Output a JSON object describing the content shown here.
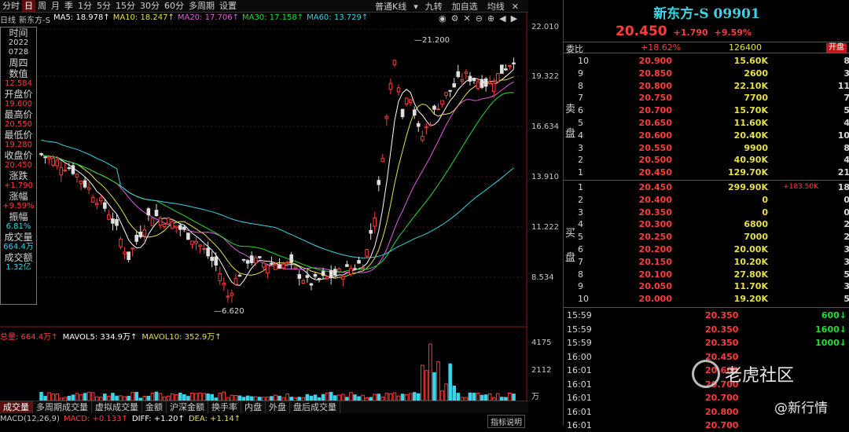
{
  "period_tabs": [
    "分时",
    "日",
    "周",
    "月",
    "季",
    "1分",
    "5分",
    "15分",
    "30分",
    "60分",
    "多周期",
    "设置"
  ],
  "active_period": "日",
  "toolbar": {
    "kline_type": "普通K线",
    "nine_turn": "九转",
    "add_watch": "加自选",
    "sort": "均线"
  },
  "ma_legend": [
    {
      "label": "日线",
      "color": "#c8c8c8"
    },
    {
      "label": "新东方-S",
      "color": "#c8c8c8"
    },
    {
      "label": "MA5: 18.978↑",
      "color": "#ffffff"
    },
    {
      "label": "MA10: 18.247↑",
      "color": "#e8e04a"
    },
    {
      "label": "MA20: 17.706↑",
      "color": "#e060e0"
    },
    {
      "label": "MA30: 17.158↑",
      "color": "#22dd33"
    },
    {
      "label": "MA60: 13.729↑",
      "color": "#3ad4e6"
    }
  ],
  "info_panel": [
    {
      "label": "时间",
      "value": "2022",
      "color": "#d8d8d8"
    },
    {
      "label": "",
      "value": "0728",
      "color": "#d8d8d8"
    },
    {
      "label": "周四",
      "value": "",
      "color": "#d8d8d8"
    },
    {
      "label": "数值",
      "value": "12.584",
      "color": "#ff3b3b"
    },
    {
      "label": "开盘价",
      "value": "19.600",
      "color": "#ff3b3b"
    },
    {
      "label": "最高价",
      "value": "20.550",
      "color": "#ff3b3b"
    },
    {
      "label": "最低价",
      "value": "19.280",
      "color": "#ff3b3b"
    },
    {
      "label": "收盘价",
      "value": "20.450",
      "color": "#ff3b3b"
    },
    {
      "label": "涨跌",
      "value": "+1.790",
      "color": "#ff3b3b"
    },
    {
      "label": "涨幅",
      "value": "+9.59%",
      "color": "#ff3b3b"
    },
    {
      "label": "振幅",
      "value": "6.81%",
      "color": "#3ad4e6"
    },
    {
      "label": "成交量",
      "value": "664.4万",
      "color": "#3ad4e6"
    },
    {
      "label": "成交额",
      "value": "1.32亿",
      "color": "#3ad4e6"
    }
  ],
  "y_axis": [
    "22.010",
    "19.322",
    "16.634",
    "13.910",
    "11.222",
    "8.534",
    "4175",
    "2112",
    "万"
  ],
  "annotations": {
    "high": "21.200",
    "low": "6.620"
  },
  "volume_legend": [
    {
      "label": "总量: 664.4万↑",
      "color": "#ff3b3b"
    },
    {
      "label": "MAVOL5: 334.9万↑",
      "color": "#ffffff"
    },
    {
      "label": "MAVOL10: 352.9万↑",
      "color": "#e8e04a"
    }
  ],
  "bottom_tabs": [
    "成交量",
    "多周期成交量",
    "虚拟成交量",
    "金额",
    "沪深金额",
    "换手率",
    "内盘",
    "外盘",
    "盘后成交量"
  ],
  "active_bottom_tab": "成交量",
  "macd_legend": [
    {
      "label": "MACD(12,26,9)",
      "color": "#c8c8c8"
    },
    {
      "label": "MACD: +0.133↑",
      "color": "#ff3b3b"
    },
    {
      "label": "DIFF: +1.20↑",
      "color": "#ffffff"
    },
    {
      "label": "DEA: +1.14↑",
      "color": "#e8e04a"
    }
  ],
  "indicator_button": "指标说明",
  "quote": {
    "name": "新东方-S 09901",
    "price": "20.450",
    "change": "+1.790",
    "change_pct": "+9.59%",
    "weibi_label": "委比",
    "weibi_value": "+18.62%",
    "weicha_value": "126400",
    "open_badge": "开盘"
  },
  "ask_label": [
    "卖",
    "盘"
  ],
  "bid_label": [
    "买",
    "盘"
  ],
  "asks": [
    {
      "level": "10",
      "price": "20.900",
      "vol": "15.60K",
      "cnt": "8"
    },
    {
      "level": "9",
      "price": "20.850",
      "vol": "2600",
      "cnt": "3"
    },
    {
      "level": "8",
      "price": "20.800",
      "vol": "22.10K",
      "cnt": "11"
    },
    {
      "level": "7",
      "price": "20.750",
      "vol": "7700",
      "cnt": "7"
    },
    {
      "level": "6",
      "price": "20.700",
      "vol": "15.70K",
      "cnt": "5"
    },
    {
      "level": "5",
      "price": "20.650",
      "vol": "11.60K",
      "cnt": "4"
    },
    {
      "level": "4",
      "price": "20.600",
      "vol": "20.40K",
      "cnt": "10"
    },
    {
      "level": "3",
      "price": "20.550",
      "vol": "9900",
      "cnt": "8"
    },
    {
      "level": "2",
      "price": "20.500",
      "vol": "40.90K",
      "cnt": "4"
    },
    {
      "level": "1",
      "price": "20.450",
      "vol": "129.70K",
      "cnt": "21"
    }
  ],
  "bids": [
    {
      "level": "1",
      "price": "20.450",
      "vol": "299.90K",
      "chg": "+183.50K",
      "cnt": "18"
    },
    {
      "level": "2",
      "price": "20.400",
      "vol": "0",
      "chg": "",
      "cnt": "0"
    },
    {
      "level": "3",
      "price": "20.350",
      "vol": "0",
      "chg": "",
      "cnt": "0"
    },
    {
      "level": "4",
      "price": "20.300",
      "vol": "6800",
      "chg": "",
      "cnt": "2"
    },
    {
      "level": "5",
      "price": "20.250",
      "vol": "7000",
      "chg": "",
      "cnt": "2"
    },
    {
      "level": "6",
      "price": "20.200",
      "vol": "20.00K",
      "chg": "",
      "cnt": "3"
    },
    {
      "level": "7",
      "price": "20.150",
      "vol": "10.20K",
      "chg": "",
      "cnt": "3"
    },
    {
      "level": "8",
      "price": "20.100",
      "vol": "27.80K",
      "chg": "",
      "cnt": "5"
    },
    {
      "level": "9",
      "price": "20.050",
      "vol": "11.70K",
      "chg": "",
      "cnt": "3"
    },
    {
      "level": "10",
      "price": "20.000",
      "vol": "19.20K",
      "chg": "",
      "cnt": "5"
    }
  ],
  "ticks": [
    {
      "time": "15:59",
      "price": "20.350",
      "vol": "600↓"
    },
    {
      "time": "15:59",
      "price": "20.350",
      "vol": "1600↓"
    },
    {
      "time": "15:59",
      "price": "20.350",
      "vol": "1000↓"
    },
    {
      "time": "16:00",
      "price": "20.450",
      "vol": ""
    },
    {
      "time": "16:01",
      "price": "20.600",
      "vol": ""
    },
    {
      "time": "16:01",
      "price": "20.700",
      "vol": ""
    },
    {
      "time": "16:01",
      "price": "20.700",
      "vol": ""
    },
    {
      "time": "16:01",
      "price": "20.800",
      "vol": ""
    },
    {
      "time": "16:01",
      "price": "20.700",
      "vol": ""
    }
  ],
  "watermark": {
    "brand": "老虎社区",
    "handle": "@新行情"
  }
}
